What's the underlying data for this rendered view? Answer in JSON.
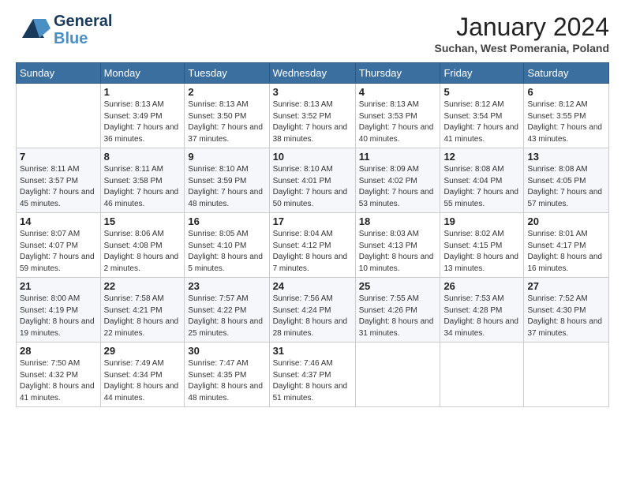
{
  "logo": {
    "line1": "General",
    "line2": "Blue"
  },
  "title": "January 2024",
  "location": "Suchan, West Pomerania, Poland",
  "days_of_week": [
    "Sunday",
    "Monday",
    "Tuesday",
    "Wednesday",
    "Thursday",
    "Friday",
    "Saturday"
  ],
  "weeks": [
    [
      {
        "day": "",
        "sunrise": "",
        "sunset": "",
        "daylight": ""
      },
      {
        "day": "1",
        "sunrise": "Sunrise: 8:13 AM",
        "sunset": "Sunset: 3:49 PM",
        "daylight": "Daylight: 7 hours and 36 minutes."
      },
      {
        "day": "2",
        "sunrise": "Sunrise: 8:13 AM",
        "sunset": "Sunset: 3:50 PM",
        "daylight": "Daylight: 7 hours and 37 minutes."
      },
      {
        "day": "3",
        "sunrise": "Sunrise: 8:13 AM",
        "sunset": "Sunset: 3:52 PM",
        "daylight": "Daylight: 7 hours and 38 minutes."
      },
      {
        "day": "4",
        "sunrise": "Sunrise: 8:13 AM",
        "sunset": "Sunset: 3:53 PM",
        "daylight": "Daylight: 7 hours and 40 minutes."
      },
      {
        "day": "5",
        "sunrise": "Sunrise: 8:12 AM",
        "sunset": "Sunset: 3:54 PM",
        "daylight": "Daylight: 7 hours and 41 minutes."
      },
      {
        "day": "6",
        "sunrise": "Sunrise: 8:12 AM",
        "sunset": "Sunset: 3:55 PM",
        "daylight": "Daylight: 7 hours and 43 minutes."
      }
    ],
    [
      {
        "day": "7",
        "sunrise": "Sunrise: 8:11 AM",
        "sunset": "Sunset: 3:57 PM",
        "daylight": "Daylight: 7 hours and 45 minutes."
      },
      {
        "day": "8",
        "sunrise": "Sunrise: 8:11 AM",
        "sunset": "Sunset: 3:58 PM",
        "daylight": "Daylight: 7 hours and 46 minutes."
      },
      {
        "day": "9",
        "sunrise": "Sunrise: 8:10 AM",
        "sunset": "Sunset: 3:59 PM",
        "daylight": "Daylight: 7 hours and 48 minutes."
      },
      {
        "day": "10",
        "sunrise": "Sunrise: 8:10 AM",
        "sunset": "Sunset: 4:01 PM",
        "daylight": "Daylight: 7 hours and 50 minutes."
      },
      {
        "day": "11",
        "sunrise": "Sunrise: 8:09 AM",
        "sunset": "Sunset: 4:02 PM",
        "daylight": "Daylight: 7 hours and 53 minutes."
      },
      {
        "day": "12",
        "sunrise": "Sunrise: 8:08 AM",
        "sunset": "Sunset: 4:04 PM",
        "daylight": "Daylight: 7 hours and 55 minutes."
      },
      {
        "day": "13",
        "sunrise": "Sunrise: 8:08 AM",
        "sunset": "Sunset: 4:05 PM",
        "daylight": "Daylight: 7 hours and 57 minutes."
      }
    ],
    [
      {
        "day": "14",
        "sunrise": "Sunrise: 8:07 AM",
        "sunset": "Sunset: 4:07 PM",
        "daylight": "Daylight: 7 hours and 59 minutes."
      },
      {
        "day": "15",
        "sunrise": "Sunrise: 8:06 AM",
        "sunset": "Sunset: 4:08 PM",
        "daylight": "Daylight: 8 hours and 2 minutes."
      },
      {
        "day": "16",
        "sunrise": "Sunrise: 8:05 AM",
        "sunset": "Sunset: 4:10 PM",
        "daylight": "Daylight: 8 hours and 5 minutes."
      },
      {
        "day": "17",
        "sunrise": "Sunrise: 8:04 AM",
        "sunset": "Sunset: 4:12 PM",
        "daylight": "Daylight: 8 hours and 7 minutes."
      },
      {
        "day": "18",
        "sunrise": "Sunrise: 8:03 AM",
        "sunset": "Sunset: 4:13 PM",
        "daylight": "Daylight: 8 hours and 10 minutes."
      },
      {
        "day": "19",
        "sunrise": "Sunrise: 8:02 AM",
        "sunset": "Sunset: 4:15 PM",
        "daylight": "Daylight: 8 hours and 13 minutes."
      },
      {
        "day": "20",
        "sunrise": "Sunrise: 8:01 AM",
        "sunset": "Sunset: 4:17 PM",
        "daylight": "Daylight: 8 hours and 16 minutes."
      }
    ],
    [
      {
        "day": "21",
        "sunrise": "Sunrise: 8:00 AM",
        "sunset": "Sunset: 4:19 PM",
        "daylight": "Daylight: 8 hours and 19 minutes."
      },
      {
        "day": "22",
        "sunrise": "Sunrise: 7:58 AM",
        "sunset": "Sunset: 4:21 PM",
        "daylight": "Daylight: 8 hours and 22 minutes."
      },
      {
        "day": "23",
        "sunrise": "Sunrise: 7:57 AM",
        "sunset": "Sunset: 4:22 PM",
        "daylight": "Daylight: 8 hours and 25 minutes."
      },
      {
        "day": "24",
        "sunrise": "Sunrise: 7:56 AM",
        "sunset": "Sunset: 4:24 PM",
        "daylight": "Daylight: 8 hours and 28 minutes."
      },
      {
        "day": "25",
        "sunrise": "Sunrise: 7:55 AM",
        "sunset": "Sunset: 4:26 PM",
        "daylight": "Daylight: 8 hours and 31 minutes."
      },
      {
        "day": "26",
        "sunrise": "Sunrise: 7:53 AM",
        "sunset": "Sunset: 4:28 PM",
        "daylight": "Daylight: 8 hours and 34 minutes."
      },
      {
        "day": "27",
        "sunrise": "Sunrise: 7:52 AM",
        "sunset": "Sunset: 4:30 PM",
        "daylight": "Daylight: 8 hours and 37 minutes."
      }
    ],
    [
      {
        "day": "28",
        "sunrise": "Sunrise: 7:50 AM",
        "sunset": "Sunset: 4:32 PM",
        "daylight": "Daylight: 8 hours and 41 minutes."
      },
      {
        "day": "29",
        "sunrise": "Sunrise: 7:49 AM",
        "sunset": "Sunset: 4:34 PM",
        "daylight": "Daylight: 8 hours and 44 minutes."
      },
      {
        "day": "30",
        "sunrise": "Sunrise: 7:47 AM",
        "sunset": "Sunset: 4:35 PM",
        "daylight": "Daylight: 8 hours and 48 minutes."
      },
      {
        "day": "31",
        "sunrise": "Sunrise: 7:46 AM",
        "sunset": "Sunset: 4:37 PM",
        "daylight": "Daylight: 8 hours and 51 minutes."
      },
      {
        "day": "",
        "sunrise": "",
        "sunset": "",
        "daylight": ""
      },
      {
        "day": "",
        "sunrise": "",
        "sunset": "",
        "daylight": ""
      },
      {
        "day": "",
        "sunrise": "",
        "sunset": "",
        "daylight": ""
      }
    ]
  ]
}
